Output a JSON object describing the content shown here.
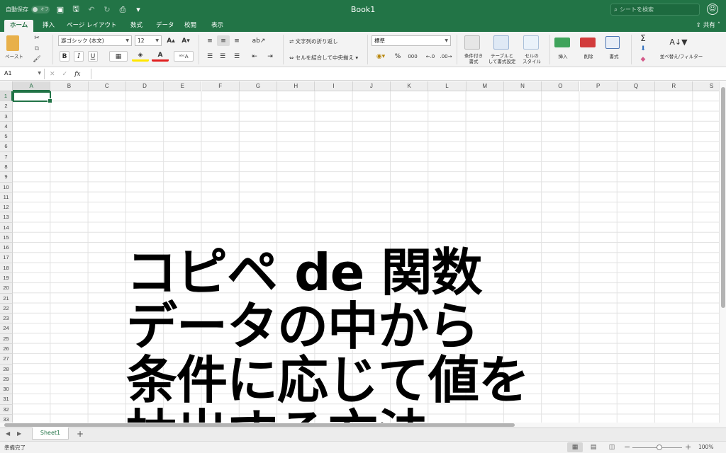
{
  "window": {
    "title": "Book1",
    "autosave_label": "自動保存",
    "autosave_state": "オフ",
    "search_placeholder": "シートを検索",
    "share_label": "共有"
  },
  "tabs": [
    "ホーム",
    "挿入",
    "ページ レイアウト",
    "数式",
    "データ",
    "校閲",
    "表示"
  ],
  "active_tab": "ホーム",
  "ribbon": {
    "paste_label": "ペースト",
    "font_name": "游ゴシック (本文)",
    "font_size": "12",
    "bold": "B",
    "italic": "I",
    "underline": "U",
    "wrap_text": "文字列の折り返し",
    "merge_center": "セルを結合して中央揃え",
    "number_format": "標準",
    "percent": "%",
    "thousands": "000",
    "cond_format": [
      "条件付き",
      "書式"
    ],
    "table_format": [
      "テーブルと",
      "して書式設定"
    ],
    "cell_style": [
      "セルの",
      "スタイル"
    ],
    "insert": "挿入",
    "delete": "削除",
    "format": "書式",
    "sort_filter": "並べ替え/フィルター",
    "sum": "Σ"
  },
  "formula_bar": {
    "name_box": "A1",
    "fx": "fx",
    "content": ""
  },
  "grid": {
    "columns": [
      "A",
      "B",
      "C",
      "D",
      "E",
      "F",
      "G",
      "H",
      "I",
      "J",
      "K",
      "L",
      "M",
      "N",
      "O",
      "P",
      "Q",
      "R",
      "S"
    ],
    "rows": [
      "1",
      "2",
      "3",
      "4",
      "5",
      "6",
      "7",
      "8",
      "9",
      "10",
      "11",
      "12",
      "13",
      "14",
      "15",
      "16",
      "17",
      "18",
      "19",
      "20",
      "21",
      "22",
      "23",
      "24",
      "25",
      "26",
      "27",
      "28",
      "29",
      "30",
      "31",
      "32",
      "33"
    ],
    "active_cell": "A1"
  },
  "overlay_text": [
    "コピペ de 関数",
    "データの中から",
    "条件に応じて値を",
    "抽出する方法"
  ],
  "sheets": [
    "Sheet1"
  ],
  "statusbar": {
    "status": "準備完了",
    "zoom": "100%",
    "zoom_minus": "−",
    "zoom_plus": "+"
  }
}
